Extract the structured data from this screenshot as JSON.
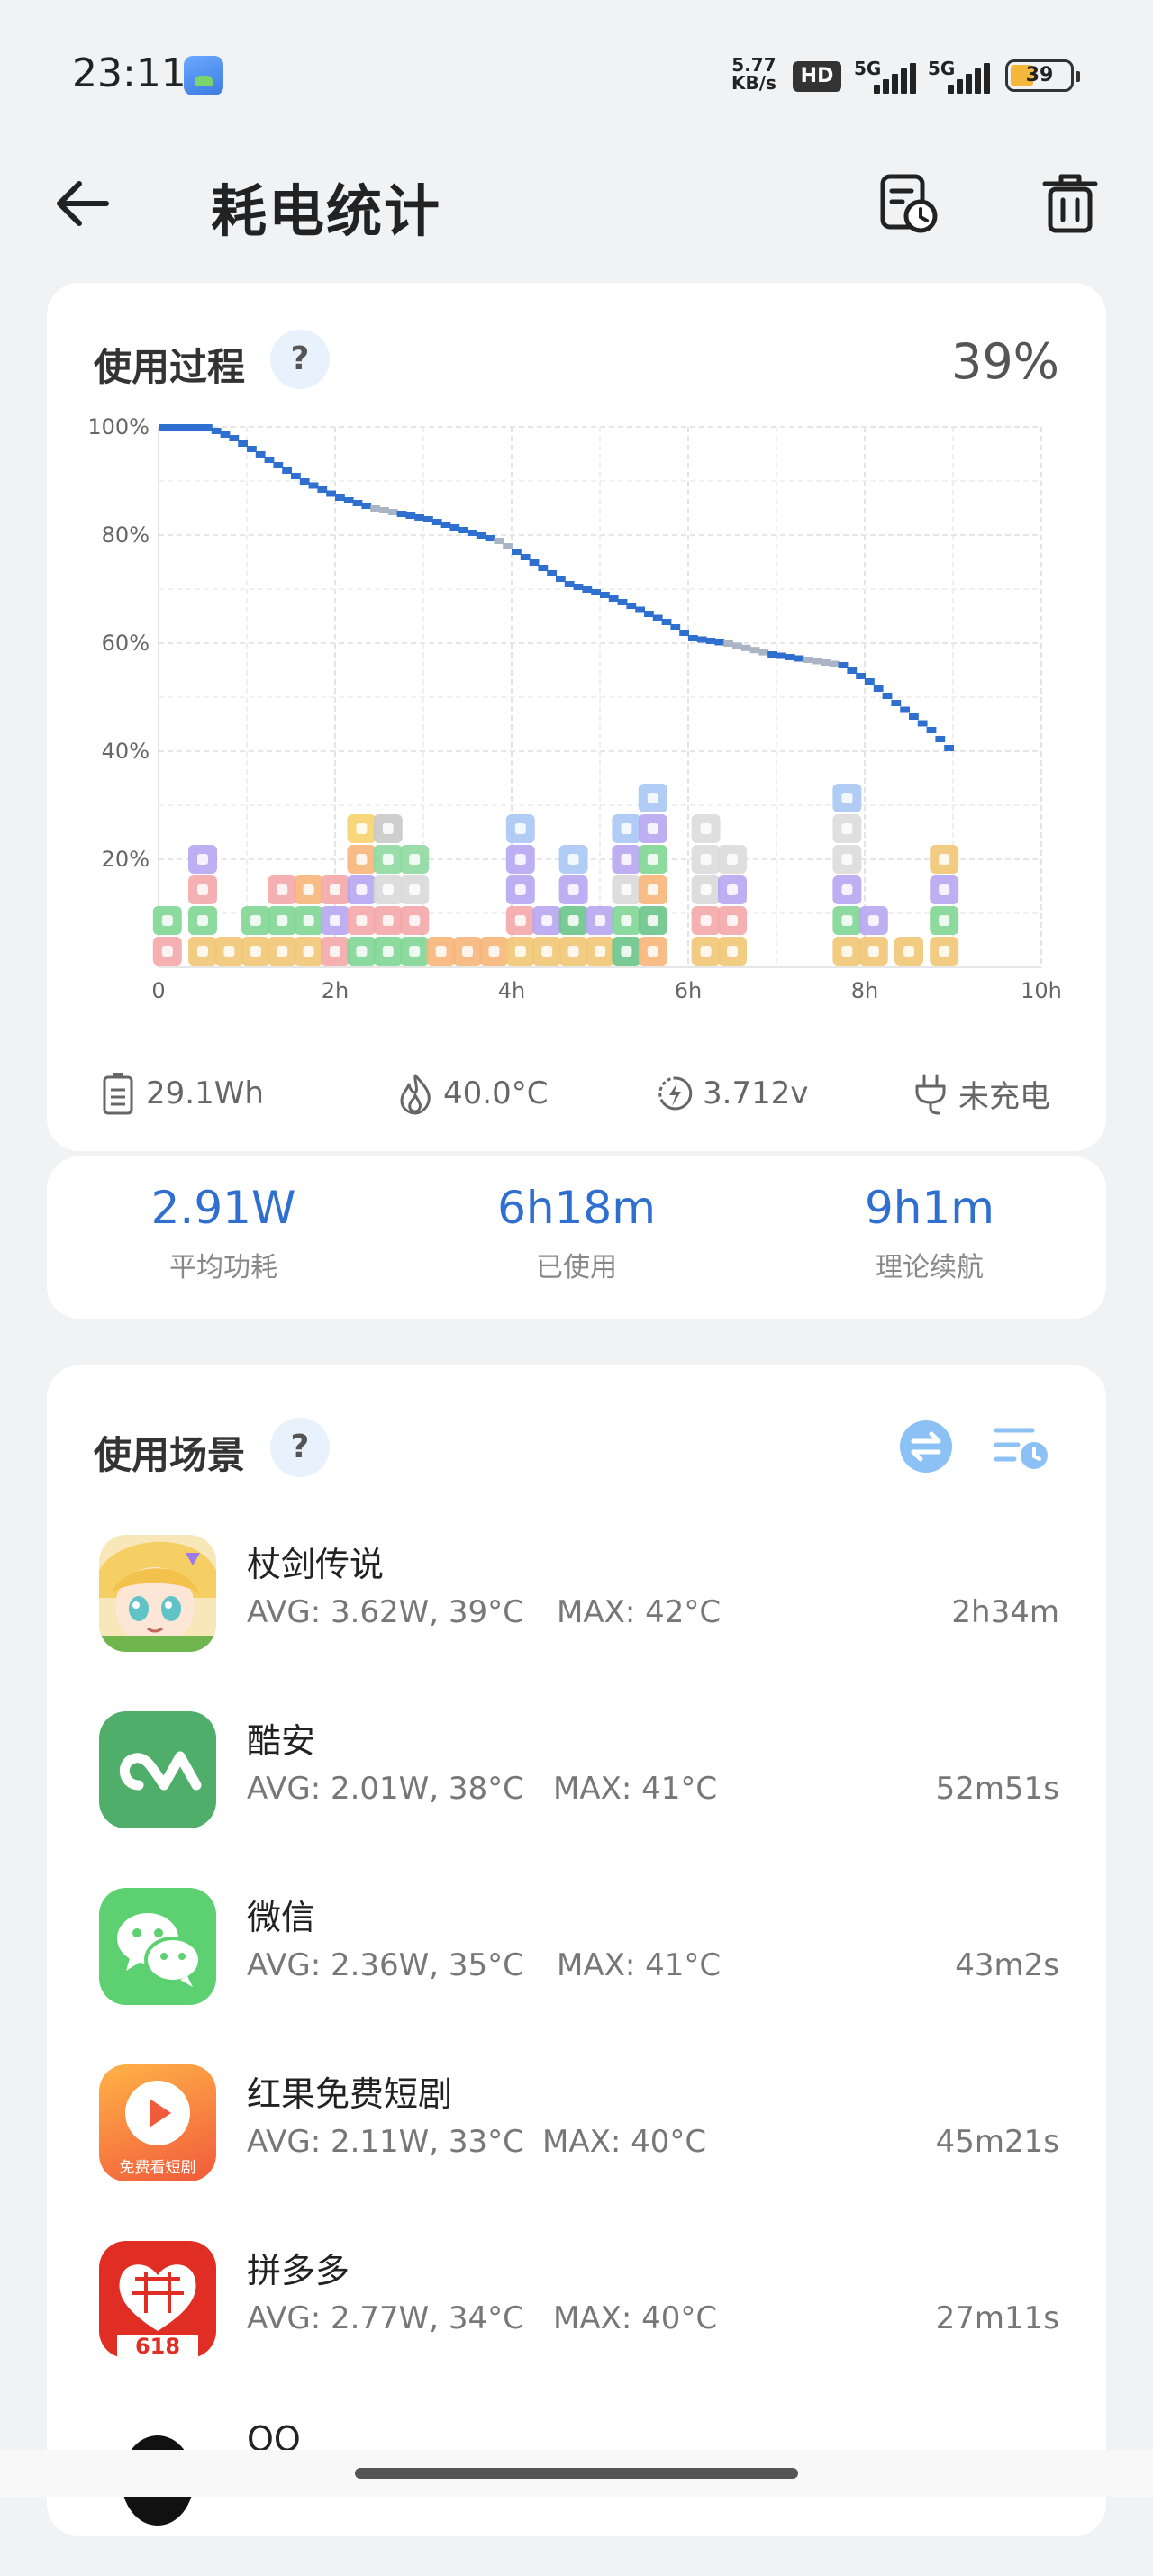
{
  "status_bar": {
    "time": "23:11",
    "net_speed_top": "5.77",
    "net_speed_bottom": "KB/s",
    "hd_label": "HD",
    "sim1_label": "5G",
    "sim2_label": "5G",
    "battery_level": "39",
    "battery_fill_fraction": 0.39,
    "icons": [
      "app-notification-icon",
      "hd-icon",
      "signal-icon",
      "signal-icon",
      "battery-icon"
    ]
  },
  "header": {
    "title": "耗电统计",
    "icons": [
      "back-arrow-icon",
      "schedule-history-icon",
      "trash-icon"
    ]
  },
  "usage_process": {
    "title": "使用过程",
    "help": "?",
    "battery_percent": "39%",
    "stats": {
      "capacity": "29.1Wh",
      "temperature": "40.0°C",
      "voltage": "3.712v",
      "charge_status": "未充电"
    },
    "stat_icons": [
      "battery-icon",
      "flame-icon",
      "voltage-icon",
      "plug-icon"
    ]
  },
  "summary": {
    "avg_power_value": "2.91W",
    "avg_power_label": "平均功耗",
    "used_value": "6h18m",
    "used_label": "已使用",
    "endurance_value": "9h1m",
    "endurance_label": "理论续航"
  },
  "scenes": {
    "title": "使用场景",
    "help": "?",
    "controls": [
      "swap-icon",
      "list-time-icon"
    ],
    "apps": [
      {
        "name": "杖剑传说",
        "avg": "AVG: 3.62W, 39°C",
        "max": "MAX:  42°C",
        "duration": "2h34m",
        "icon": "game-character-icon"
      },
      {
        "name": "酷安",
        "avg": "AVG: 2.01W, 38°C",
        "max": "MAX:  41°C",
        "duration": "52m51s",
        "icon": "coolapk-icon"
      },
      {
        "name": "微信",
        "avg": "AVG: 2.36W, 35°C",
        "max": "MAX:  41°C",
        "duration": "43m2s",
        "icon": "wechat-icon"
      },
      {
        "name": "红果免费短剧",
        "avg": "AVG: 2.11W, 33°C",
        "max": "MAX:  40°C",
        "duration": "45m21s",
        "icon": "hongguo-icon",
        "icon_caption": "免费看短剧"
      },
      {
        "name": "拼多多",
        "avg": "AVG: 2.77W, 34°C",
        "max": "MAX:  40°C",
        "duration": "27m11s",
        "icon": "pinduoduo-icon",
        "icon_caption": "618"
      },
      {
        "name": "QQ",
        "icon": "qq-icon"
      }
    ]
  },
  "chart_data": {
    "type": "line",
    "title": "",
    "xlabel": "",
    "ylabel": "",
    "x_ticks": [
      "0",
      "2h",
      "4h",
      "6h",
      "8h",
      "10h"
    ],
    "y_ticks": [
      "20%",
      "40%",
      "60%",
      "80%",
      "100%"
    ],
    "xlim": [
      0,
      10
    ],
    "ylim": [
      0,
      100
    ],
    "grid": true,
    "series": [
      {
        "x_hours": [
          0,
          0.5,
          0.8,
          1.2,
          1.6,
          2.0,
          2.4,
          2.7,
          3.0,
          3.4,
          3.8,
          4.0,
          4.3,
          4.6,
          5.0,
          5.3,
          5.7,
          6.0,
          6.4,
          6.9,
          7.3,
          7.7,
          8.0,
          8.3,
          8.7,
          9.0
        ],
        "battery_percent": [
          100,
          100,
          98,
          94,
          90,
          87,
          85,
          84,
          83,
          81,
          79,
          77,
          74,
          71,
          69,
          67,
          64,
          61,
          60,
          58,
          57,
          56,
          53,
          49,
          44,
          39
        ]
      }
    ],
    "activity_stacks": [
      {
        "x_hours": 0.1,
        "apps": [
          "pinduoduo",
          "wechat"
        ]
      },
      {
        "x_hours": 0.5,
        "apps": [
          "game",
          "wechat",
          "pinduoduo",
          "home"
        ]
      },
      {
        "x_hours": 0.8,
        "apps": [
          "game"
        ]
      },
      {
        "x_hours": 1.1,
        "apps": [
          "game",
          "wechat"
        ]
      },
      {
        "x_hours": 1.4,
        "apps": [
          "game",
          "wechat",
          "pinduoduo"
        ]
      },
      {
        "x_hours": 1.7,
        "apps": [
          "game",
          "wechat",
          "hongguo"
        ]
      },
      {
        "x_hours": 2.0,
        "apps": [
          "pinduoduo",
          "home",
          "pinduoduo"
        ]
      },
      {
        "x_hours": 2.3,
        "apps": [
          "wechat",
          "pinduoduo",
          "home",
          "hongguo",
          "notes"
        ]
      },
      {
        "x_hours": 2.6,
        "apps": [
          "wechat",
          "pinduoduo",
          "qq",
          "phone",
          "clock"
        ]
      },
      {
        "x_hours": 2.9,
        "apps": [
          "wechat",
          "pinduoduo",
          "qq",
          "phone"
        ]
      },
      {
        "x_hours": 3.2,
        "apps": [
          "hongguo"
        ]
      },
      {
        "x_hours": 3.5,
        "apps": [
          "hongguo"
        ]
      },
      {
        "x_hours": 3.8,
        "apps": [
          "hongguo"
        ]
      },
      {
        "x_hours": 4.1,
        "apps": [
          "game",
          "pinduoduo",
          "home",
          "home",
          "weather"
        ]
      },
      {
        "x_hours": 4.4,
        "apps": [
          "game",
          "home"
        ]
      },
      {
        "x_hours": 4.7,
        "apps": [
          "game",
          "coolapk",
          "home",
          "weather"
        ]
      },
      {
        "x_hours": 5.0,
        "apps": [
          "game",
          "home"
        ]
      },
      {
        "x_hours": 5.3,
        "apps": [
          "coolapk",
          "wechat",
          "qq",
          "home",
          "weather"
        ]
      },
      {
        "x_hours": 5.6,
        "apps": [
          "hongguo",
          "coolapk",
          "hongguo",
          "wechat",
          "home",
          "weather"
        ]
      },
      {
        "x_hours": 6.2,
        "apps": [
          "game",
          "pinduoduo",
          "qq",
          "settings",
          "settings"
        ]
      },
      {
        "x_hours": 6.5,
        "apps": [
          "game",
          "pinduoduo",
          "home",
          "settings"
        ]
      },
      {
        "x_hours": 7.8,
        "apps": [
          "game",
          "wechat",
          "home",
          "settings",
          "settings",
          "weather"
        ]
      },
      {
        "x_hours": 8.1,
        "apps": [
          "game",
          "home"
        ]
      },
      {
        "x_hours": 8.5,
        "apps": [
          "game"
        ]
      },
      {
        "x_hours": 8.9,
        "apps": [
          "game",
          "wechat",
          "home",
          "game"
        ]
      }
    ]
  }
}
